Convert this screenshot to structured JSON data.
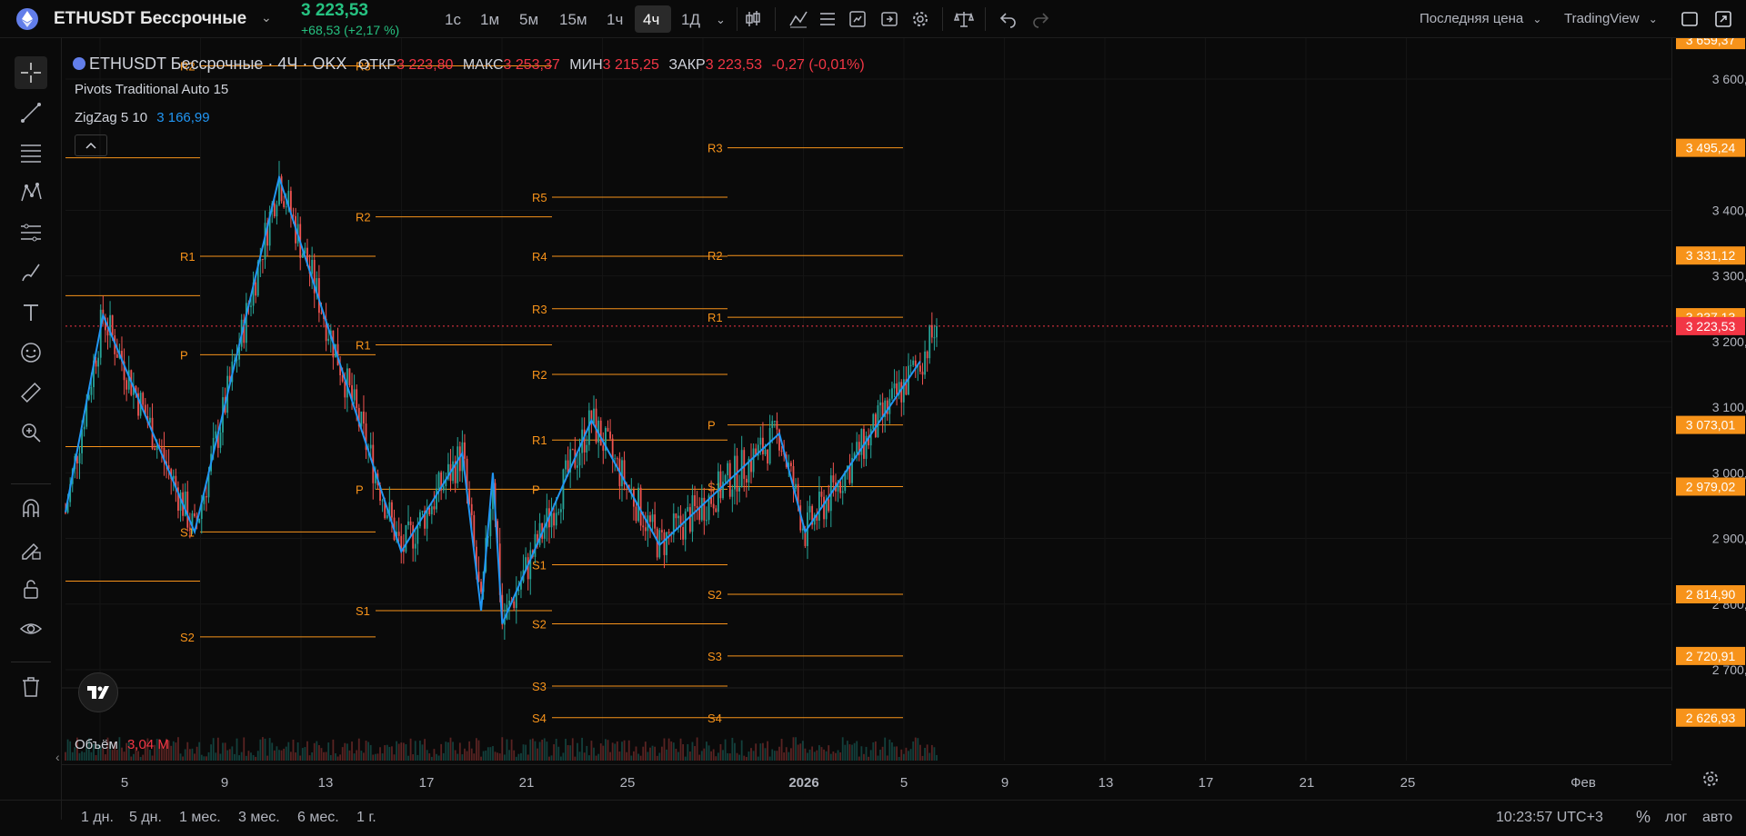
{
  "symbol": {
    "name": "ETHUSDT Бессрочные",
    "price": "3 223,53",
    "change": "+68,53 (+2,17 %)"
  },
  "timeframes": [
    "1с",
    "1м",
    "5м",
    "15м",
    "1ч",
    "4ч",
    "1Д"
  ],
  "active_timeframe": "4ч",
  "header_right": {
    "price_type": "Последняя цена",
    "broker": "TradingView"
  },
  "legend": {
    "title": "ETHUSDT Бессрочные · 4Ч · OKX",
    "open_label": "ОТКР",
    "open_value": "3 223,80",
    "high_label": "МАКС",
    "high_value": "3 253,37",
    "low_label": "МИН",
    "low_value": "3 215,25",
    "close_label": "ЗАКР",
    "close_value": "3 223,53",
    "change_value": "-0,27 (-0,01%)",
    "indicator_pivots": "Pivots Traditional Auto 15",
    "indicator_zigzag": "ZigZag 5 10",
    "zigzag_value": "3 166,99"
  },
  "volume": {
    "label": "Объём",
    "value": "3,04 M"
  },
  "price_axis": {
    "ticks": [
      3600,
      3400,
      3300,
      3200,
      3100,
      3000,
      2900,
      2800,
      2700
    ],
    "tick_labels": [
      "3 600,00",
      "3 400,00",
      "3 300,00",
      "3 200,00",
      "3 100,00",
      "3 000,00",
      "2 900,00",
      "2 800,00",
      "2 700,00"
    ],
    "badges": [
      {
        "label": "3 659,37",
        "value": 3659.37,
        "color": "#f7931a"
      },
      {
        "label": "3 495,24",
        "value": 3495.24,
        "color": "#f7931a"
      },
      {
        "label": "3 331,12",
        "value": 3331.12,
        "color": "#f7931a"
      },
      {
        "label": "3 237,13",
        "value": 3237.13,
        "color": "#f7931a"
      },
      {
        "label": "3 223,53",
        "value": 3223.53,
        "color": "#f23645"
      },
      {
        "label": "3 073,01",
        "value": 3073.01,
        "color": "#f7931a"
      },
      {
        "label": "2 979,02",
        "value": 2979.02,
        "color": "#f7931a"
      },
      {
        "label": "2 814,90",
        "value": 2814.9,
        "color": "#f7931a"
      },
      {
        "label": "2 720,91",
        "value": 2720.91,
        "color": "#f7931a"
      },
      {
        "label": "2 626,93",
        "value": 2626.93,
        "color": "#f7931a"
      }
    ]
  },
  "time_axis": {
    "labels": [
      "5",
      "9",
      "13",
      "17",
      "21",
      "25",
      "2026",
      "5",
      "9",
      "13",
      "17",
      "21",
      "25",
      "Фев"
    ]
  },
  "ranges": [
    "1 дн.",
    "5 дн.",
    "1 мес.",
    "3 мес.",
    "6 мес.",
    "1 г."
  ],
  "clock": "10:23:57 UTC+3",
  "scale_buttons": {
    "percent": "%",
    "log": "лог",
    "auto": "авто"
  },
  "colors": {
    "up": "#26a69a",
    "down": "#ef5350",
    "pivot": "#f7931a",
    "zigzag": "#2196f3",
    "accent": "#f7931a"
  },
  "chart_data": {
    "type": "candlestick",
    "pivot_labels": [
      "R5",
      "R4",
      "R3",
      "R2",
      "R1",
      "P",
      "S1",
      "S2",
      "S3",
      "S4"
    ],
    "pivot_periods": [
      {
        "levels": [
          {
            "label": "R2",
            "value": 3480
          },
          {
            "label": "R1",
            "value": 3270
          },
          {
            "label": "P",
            "value": 3040
          },
          {
            "label": "S1",
            "value": 2835
          }
        ]
      },
      {
        "levels": [
          {
            "label": "R2",
            "value": 3620
          },
          {
            "label": "R1",
            "value": 3330
          },
          {
            "label": "P",
            "value": 3180
          },
          {
            "label": "S1",
            "value": 2910
          },
          {
            "label": "S2",
            "value": 2750
          }
        ]
      },
      {
        "levels": [
          {
            "label": "R3",
            "value": 3620
          },
          {
            "label": "R2",
            "value": 3390
          },
          {
            "label": "R1",
            "value": 3195
          },
          {
            "label": "P",
            "value": 2975
          },
          {
            "label": "S1",
            "value": 2790
          }
        ]
      },
      {
        "levels": [
          {
            "label": "R5",
            "value": 3420
          },
          {
            "label": "R4",
            "value": 3330
          },
          {
            "label": "R3",
            "value": 3250
          },
          {
            "label": "R2",
            "value": 3150
          },
          {
            "label": "R1",
            "value": 3050
          },
          {
            "label": "P",
            "value": 2975
          },
          {
            "label": "S1",
            "value": 2860
          },
          {
            "label": "S2",
            "value": 2770
          },
          {
            "label": "S3",
            "value": 2675
          },
          {
            "label": "S4",
            "value": 2626.93
          }
        ]
      },
      {
        "levels": [
          {
            "label": "R3",
            "value": 3495.24
          },
          {
            "label": "R2",
            "value": 3331.12
          },
          {
            "label": "R1",
            "value": 3237.13
          },
          {
            "label": "P",
            "value": 3073.01
          },
          {
            "label": "S1",
            "value": 2979.02
          },
          {
            "label": "S2",
            "value": 2814.9
          },
          {
            "label": "S3",
            "value": 2720.91
          },
          {
            "label": "S4",
            "value": 2626.93
          }
        ]
      }
    ],
    "zigzag_points": [
      [
        0,
        2940
      ],
      [
        16,
        3240
      ],
      [
        55,
        2910
      ],
      [
        91,
        3450
      ],
      [
        143,
        2880
      ],
      [
        169,
        3030
      ],
      [
        177,
        2790
      ],
      [
        182,
        3000
      ],
      [
        186,
        2770
      ],
      [
        224,
        3080
      ],
      [
        253,
        2890
      ],
      [
        304,
        3060
      ],
      [
        315,
        2910
      ],
      [
        364,
        3170
      ]
    ],
    "last_price": 3223.53,
    "ylim": [
      2560,
      3700
    ]
  }
}
